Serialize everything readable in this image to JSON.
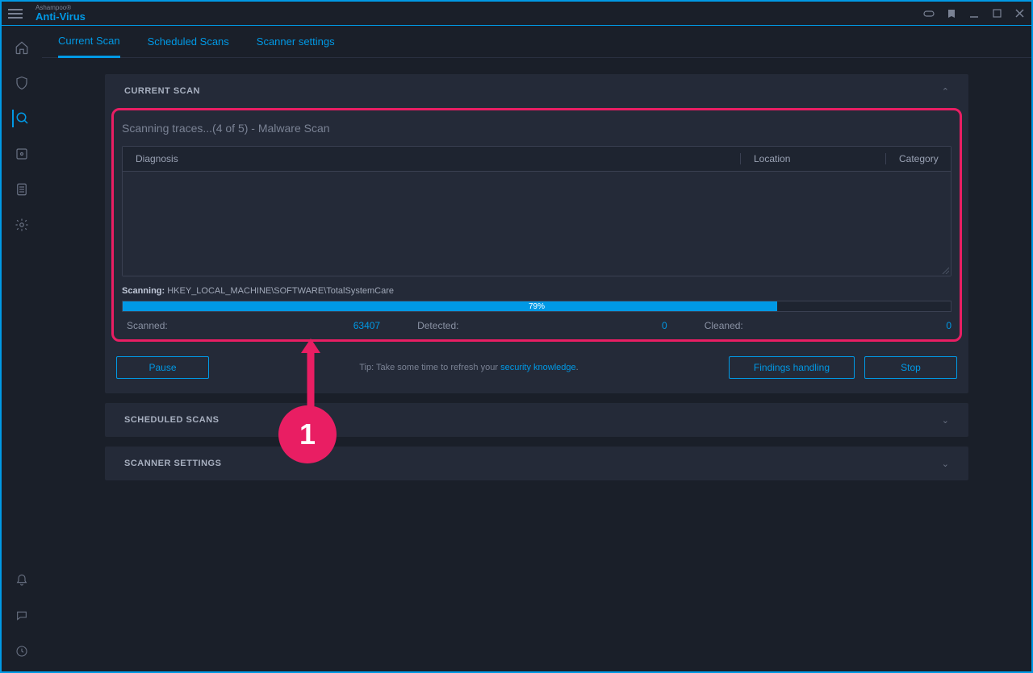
{
  "brand": {
    "sup": "Ashampoo®",
    "main": "Anti-Virus"
  },
  "tabs": {
    "current": "Current Scan",
    "scheduled": "Scheduled Scans",
    "settings": "Scanner settings"
  },
  "panels": {
    "current": "CURRENT SCAN",
    "scheduled": "SCHEDULED SCANS",
    "settings": "SCANNER SETTINGS"
  },
  "scan": {
    "status": "Scanning traces...(4 of 5) - Malware Scan",
    "columns": {
      "diag": "Diagnosis",
      "loc": "Location",
      "cat": "Category"
    },
    "path_label": "Scanning:",
    "path_value": "HKEY_LOCAL_MACHINE\\SOFTWARE\\TotalSystemCare",
    "progress_pct": 79,
    "progress_label": "79%",
    "stats": {
      "scanned_label": "Scanned:",
      "scanned_value": "63407",
      "detected_label": "Detected:",
      "detected_value": "0",
      "cleaned_label": "Cleaned:",
      "cleaned_value": "0"
    }
  },
  "actions": {
    "pause": "Pause",
    "tip_prefix": "Tip: Take some time to refresh your ",
    "tip_link": "security knowledge",
    "tip_suffix": ".",
    "findings": "Findings handling",
    "stop": "Stop"
  },
  "annotation": {
    "number": "1"
  }
}
